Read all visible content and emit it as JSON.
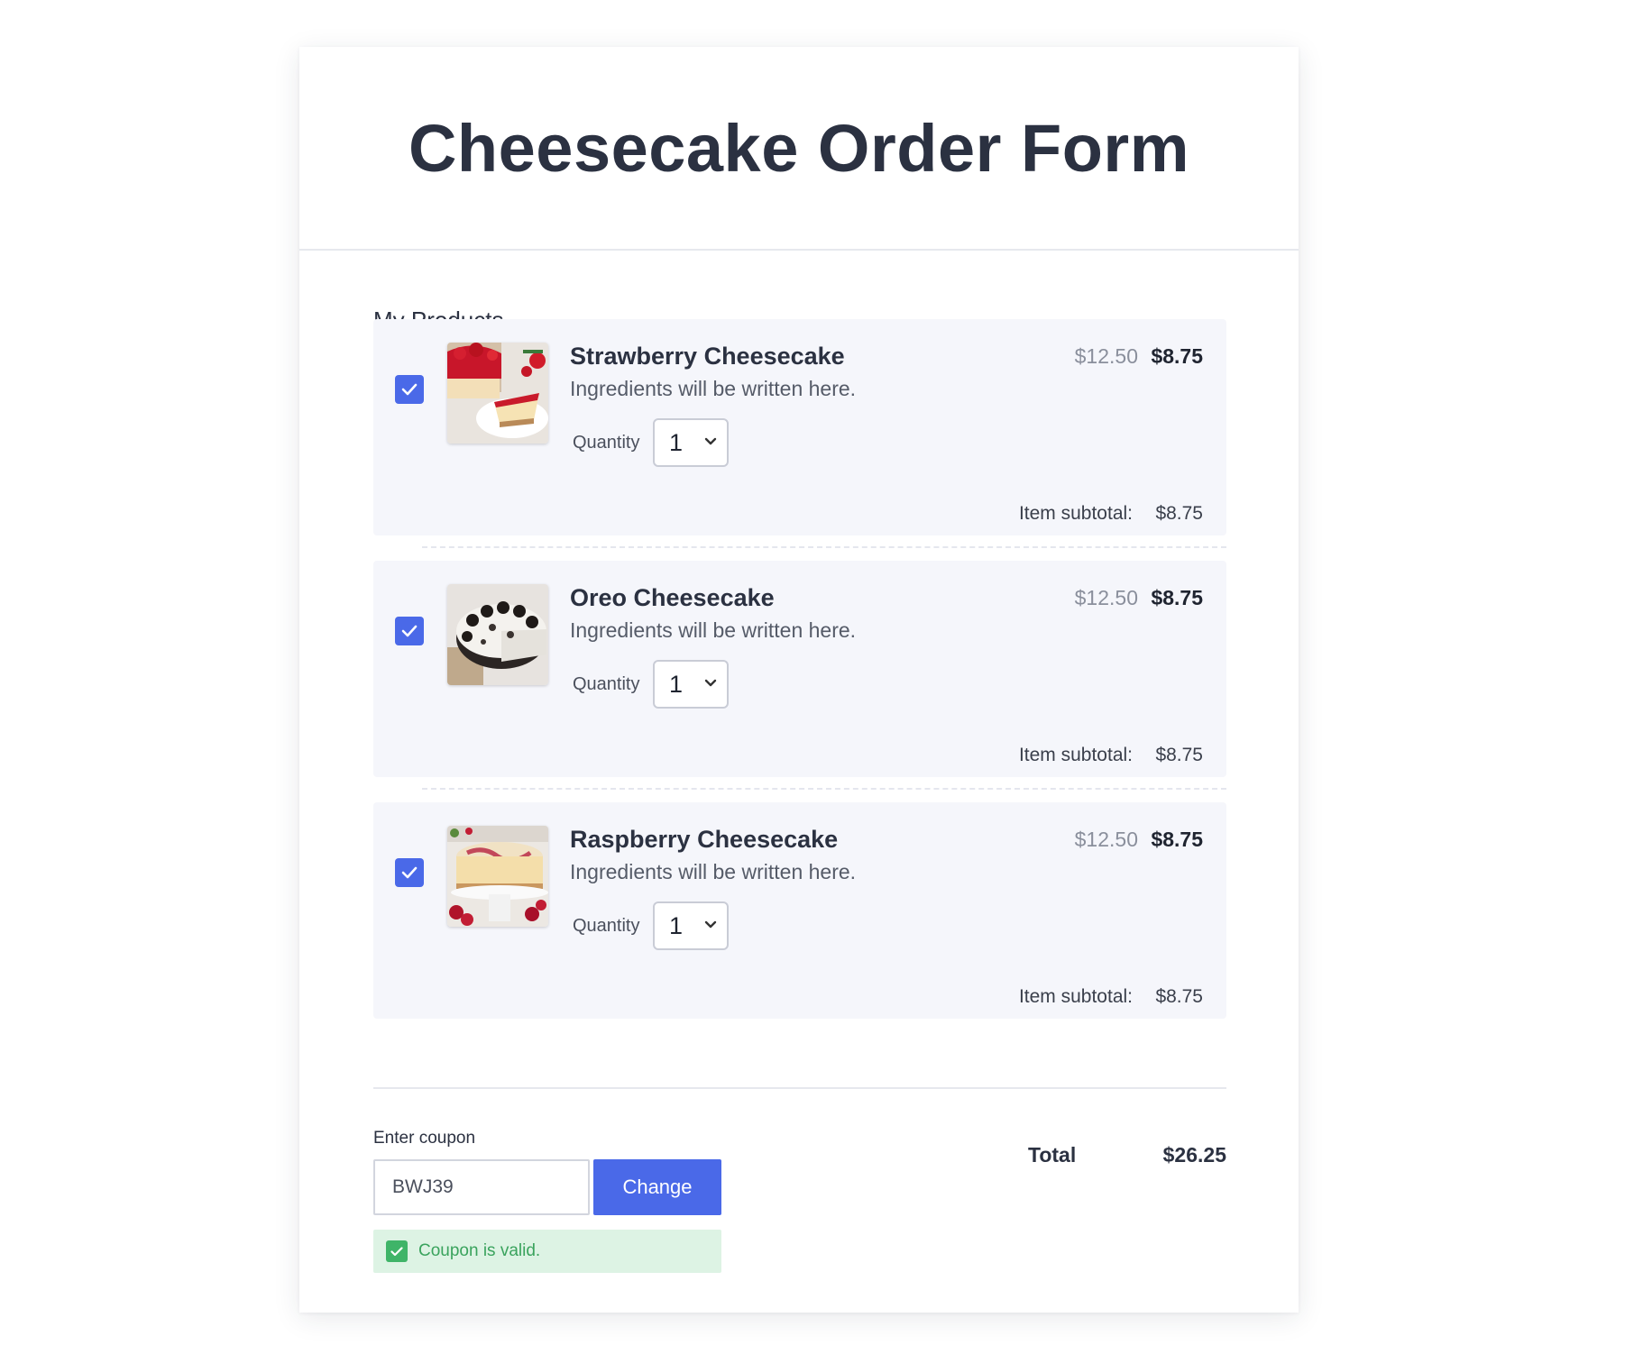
{
  "page": {
    "title": "Cheesecake Order Form"
  },
  "products_section": {
    "title": "My Products"
  },
  "quantity_label": "Quantity",
  "subtotal_label": "Item subtotal:",
  "products": [
    {
      "name": "Strawberry Cheesecake",
      "description": "Ingredients will be written here.",
      "old_price": "$12.50",
      "price": "$8.75",
      "quantity": "1",
      "subtotal": "$8.75",
      "checked": true,
      "image": "strawberry-cheesecake-image"
    },
    {
      "name": "Oreo Cheesecake",
      "description": "Ingredients will be written here.",
      "old_price": "$12.50",
      "price": "$8.75",
      "quantity": "1",
      "subtotal": "$8.75",
      "checked": true,
      "image": "oreo-cheesecake-image"
    },
    {
      "name": "Raspberry Cheesecake",
      "description": "Ingredients will be written here.",
      "old_price": "$12.50",
      "price": "$8.75",
      "quantity": "1",
      "subtotal": "$8.75",
      "checked": true,
      "image": "raspberry-cheesecake-image"
    }
  ],
  "coupon": {
    "label": "Enter coupon",
    "value": "BWJ39",
    "button_label": "Change",
    "status_text": "Coupon is valid."
  },
  "total": {
    "label": "Total",
    "value": "$26.25"
  },
  "colors": {
    "accent": "#4a69e8",
    "success": "#3fb468",
    "success_bg": "#ddf3e4",
    "product_bg": "#f5f6fb"
  }
}
